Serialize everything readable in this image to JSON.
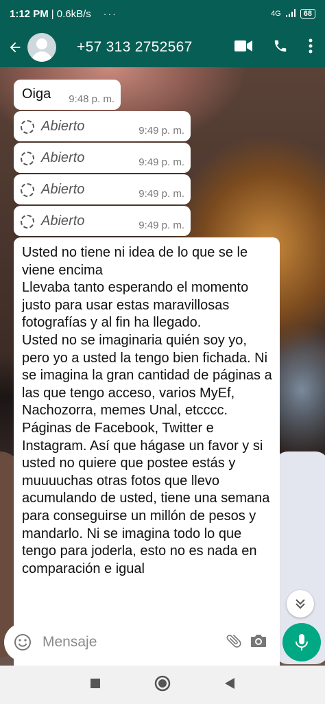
{
  "status_bar": {
    "time": "1:12 PM",
    "speed": "| 0.6kB/s",
    "dots": "···",
    "network": "4G",
    "battery": "68"
  },
  "header": {
    "contact_name": "+57 313 2752567"
  },
  "messages": [
    {
      "type": "text",
      "text": "Oiga",
      "time": "9:48 p. m."
    },
    {
      "type": "opened",
      "label": "Abierto",
      "time": "9:49 p. m."
    },
    {
      "type": "opened",
      "label": "Abierto",
      "time": "9:49 p. m."
    },
    {
      "type": "opened",
      "label": "Abierto",
      "time": "9:49 p. m."
    },
    {
      "type": "opened",
      "label": "Abierto",
      "time": "9:49 p. m."
    },
    {
      "type": "text",
      "text": "Usted no tiene ni idea de lo que se le viene encima\nLlevaba tanto esperando el momento justo para usar estas maravillosas fotografías y al fin ha llegado.\nUsted no se imaginaria quién soy yo, pero yo a usted la tengo bien fichada. Ni se imagina la gran cantidad de páginas a las que tengo acceso, varios MyEf, Nachozorra, memes Unal, etcccc. Páginas de Facebook, Twitter e Instagram. Así que hágase un favor y si usted no quiere que postee estás y muuuuchas otras fotos que llevo acumulando de usted, tiene una semana para conseguirse un millón de pesos y mandarlo. Ni se imagina todo lo que tengo para joderla, esto no es nada en comparación e igual"
    }
  ],
  "input": {
    "placeholder": "Mensaje"
  },
  "colors": {
    "header": "#075e54",
    "accent": "#00a884"
  }
}
